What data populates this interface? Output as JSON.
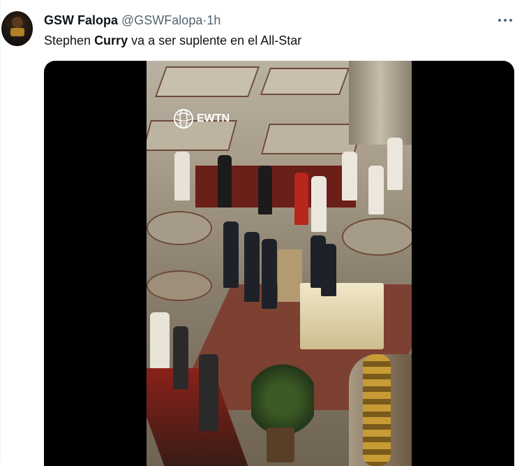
{
  "tweet": {
    "display_name": "GSW Falopa",
    "handle": "@GSWFalopa",
    "separator": "·",
    "time": "1h",
    "text_before": "Stephen ",
    "text_bold": "Curry",
    "text_after": " va a ser suplente en el All-Star"
  },
  "media": {
    "watermark": "EWTN"
  },
  "icons": {
    "avatar": "user-avatar",
    "more": "more-horizontal-icon",
    "logo": "globe-logo-icon"
  }
}
